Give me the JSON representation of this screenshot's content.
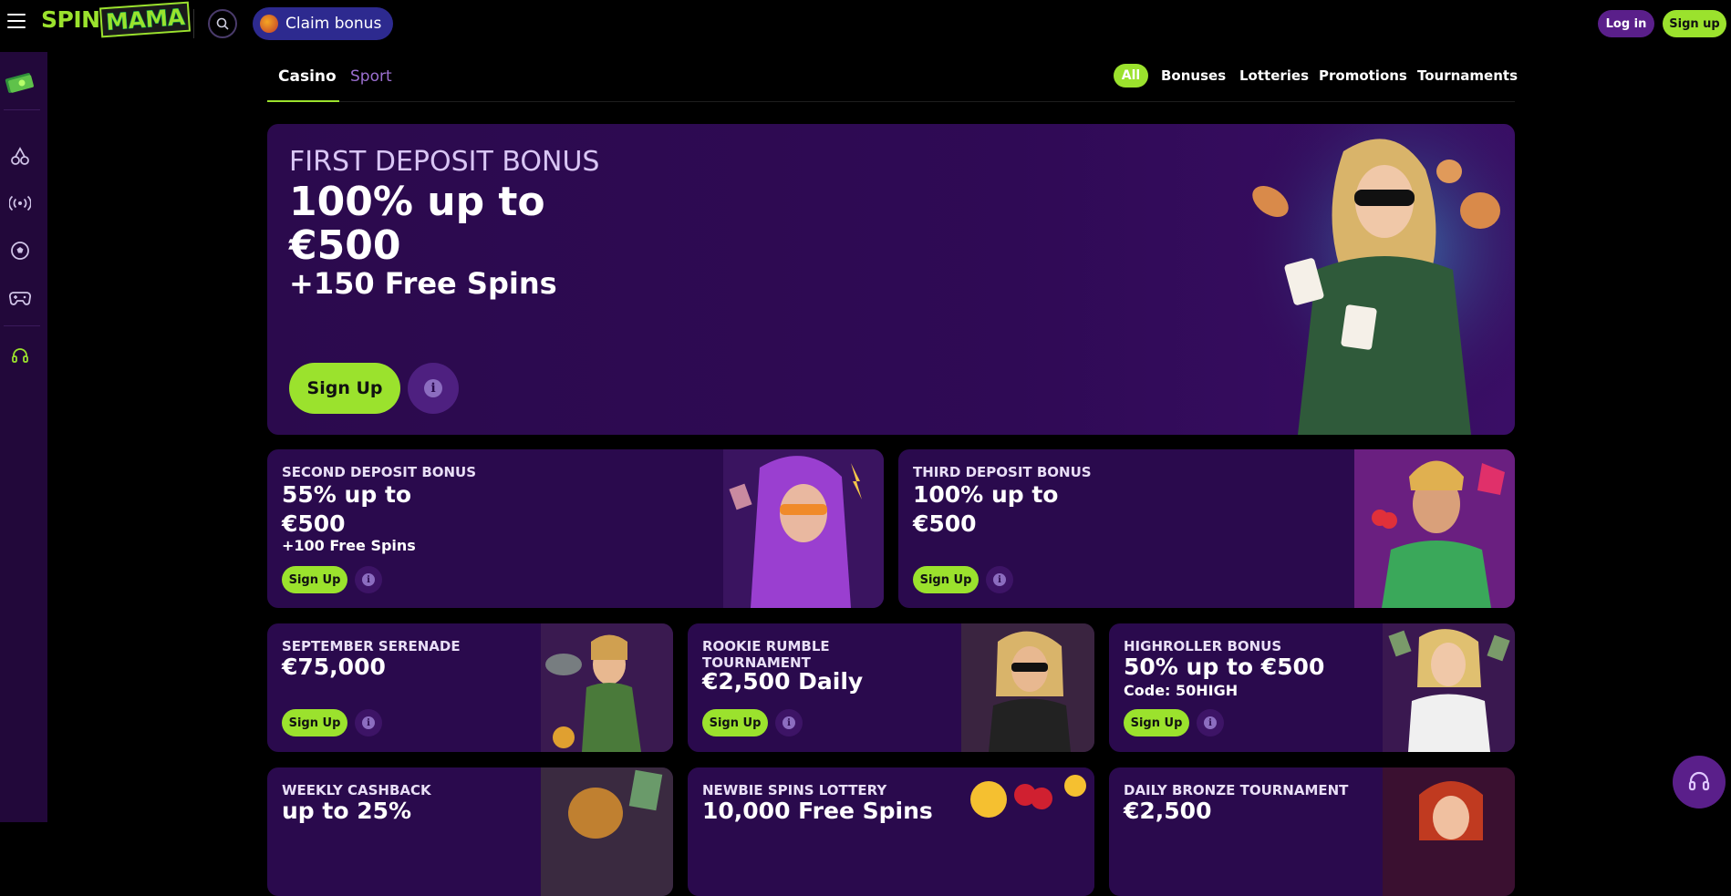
{
  "header": {
    "logo_text_a": "SPIN",
    "logo_text_b": "MAMA",
    "claim_label": "Claim bonus",
    "login_label": "Log in",
    "signup_label": "Sign up"
  },
  "sidebar": {
    "items": [
      "wallet-icon",
      "cherry-icon",
      "live-icon",
      "football-icon",
      "gamepad-icon",
      "support-icon"
    ]
  },
  "tabs": {
    "casino": "Casino",
    "sport": "Sport"
  },
  "filters": {
    "all": "All",
    "bonuses": "Bonuses",
    "lotteries": "Lotteries",
    "promotions": "Promotions",
    "tournaments": "Tournaments"
  },
  "hero": {
    "label": "FIRST DEPOSIT BONUS",
    "title": "100% up to €500",
    "spins": "+150 Free Spins",
    "cta": "Sign Up"
  },
  "cards": {
    "second": {
      "label": "SECOND DEPOSIT BONUS",
      "amount": "55% up to €500",
      "extra": "+100 Free Spins",
      "cta": "Sign Up"
    },
    "third": {
      "label": "THIRD DEPOSIT BONUS",
      "amount": "100% up to €500",
      "cta": "Sign Up"
    },
    "september": {
      "label": "SEPTEMBER SERENADE",
      "amount": "€75,000",
      "cta": "Sign Up"
    },
    "rookie": {
      "label": "ROOKIE RUMBLE TOURNAMENT",
      "amount": "€2,500 Daily",
      "cta": "Sign Up"
    },
    "highroller": {
      "label": "HIGHROLLER BONUS",
      "amount": "50% up to €500",
      "extra": "Code: 50HIGH",
      "cta": "Sign Up"
    },
    "cashback": {
      "label": "WEEKLY CASHBACK",
      "amount": "up to 25%"
    },
    "newbie": {
      "label": "NEWBIE SPINS LOTTERY",
      "amount": "10,000 Free Spins"
    },
    "bronze": {
      "label": "DAILY BRONZE TOURNAMENT",
      "amount": "€2,500"
    }
  },
  "colors": {
    "accent": "#9be22d",
    "card_bg": "#2a0a4d",
    "sidebar_bg": "#22083a",
    "claim_bg": "#2d2a8f",
    "login_bg": "#5a1f8a"
  }
}
